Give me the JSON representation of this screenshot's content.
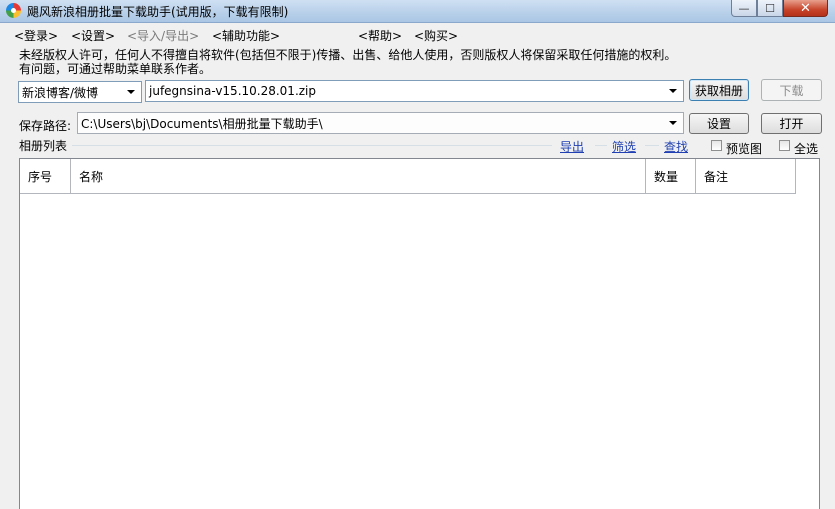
{
  "window": {
    "title": "飓风新浪相册批量下载助手(试用版，下载有限制)",
    "min_glyph": "—",
    "max_glyph": "☐",
    "close_glyph": "✕"
  },
  "menu": {
    "login": "<登录>",
    "settings": "<设置>",
    "import_export": "<导入/导出>",
    "aux": "<辅助功能>",
    "help": "<帮助>",
    "buy": "<购买>"
  },
  "notice": {
    "line1": "未经版权人许可，任何人不得擅自将软件(包括但不限于)传播、出售、给他人使用，否则版权人将保留采取任何措施的权利。",
    "line2": "有问题，可通过帮助菜单联系作者。"
  },
  "source": {
    "site_selected": "新浪博客/微博",
    "account_value": "jufegnsina-v15.10.28.01.zip",
    "get_album_button": "获取相册",
    "download_button": "下载"
  },
  "save": {
    "label": "保存路径:",
    "path_value": "C:\\Users\\bj\\Documents\\相册批量下载助手\\",
    "setup_button": "设置",
    "open_button": "打开"
  },
  "album_list": {
    "title": "相册列表",
    "export_link": "导出",
    "filter_link": "筛选",
    "find_link": "查找",
    "preview_label": "预览图",
    "select_all_label": "全选",
    "columns": [
      "序号",
      "名称",
      "数量",
      "备注"
    ]
  }
}
